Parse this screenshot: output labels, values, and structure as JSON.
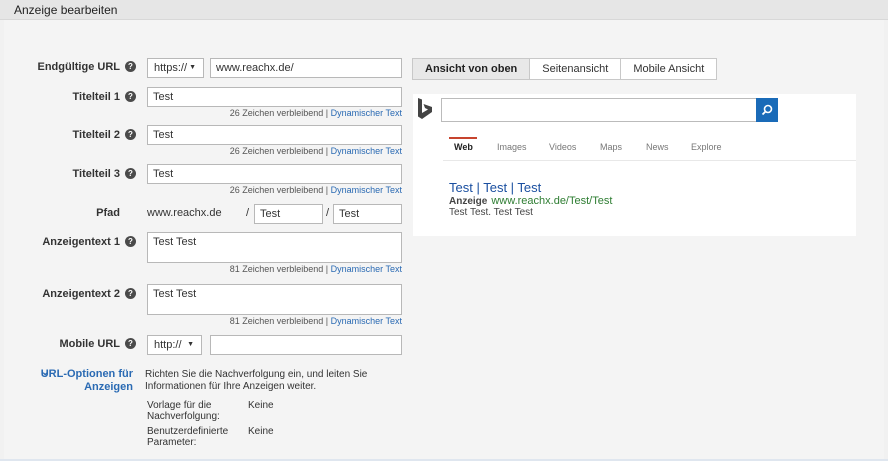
{
  "header": {
    "title": "Anzeige bearbeiten"
  },
  "form": {
    "final_url": {
      "label": "Endgültige URL",
      "protocol": "https://",
      "value": "www.reachx.de/"
    },
    "title1": {
      "label": "Titelteil 1",
      "value": "Test",
      "counter": "26 Zeichen verbleibend |",
      "dynamic": "Dynamischer Text"
    },
    "title2": {
      "label": "Titelteil 2",
      "value": "Test",
      "counter": "26 Zeichen verbleibend |",
      "dynamic": "Dynamischer Text"
    },
    "title3": {
      "label": "Titelteil 3",
      "value": "Test",
      "counter": "26 Zeichen verbleibend |",
      "dynamic": "Dynamischer Text"
    },
    "path": {
      "label": "Pfad",
      "domain": "www.reachx.de",
      "sep1": "/",
      "path1": "Test",
      "sep2": "/",
      "path2": "Test"
    },
    "text1": {
      "label": "Anzeigentext 1",
      "value": "Test Test",
      "counter": "81 Zeichen verbleibend |",
      "dynamic": "Dynamischer Text"
    },
    "text2": {
      "label": "Anzeigentext 2",
      "value": "Test Test",
      "counter": "81 Zeichen verbleibend |",
      "dynamic": "Dynamischer Text"
    },
    "mobile_url": {
      "label": "Mobile URL",
      "protocol": "http://",
      "value": ""
    },
    "url_options": {
      "label_line1": "URL-Optionen für",
      "label_line2": "Anzeigen",
      "description_line1": "Richten Sie die Nachverfolgung ein, und leiten Sie",
      "description_line2": "Informationen für Ihre Anzeigen weiter.",
      "tracking_label_line1": "Vorlage für die",
      "tracking_label_line2": "Nachverfolgung:",
      "tracking_value": "Keine",
      "custom_label_line1": "Benutzerdefinierte",
      "custom_label_line2": "Parameter:",
      "custom_value": "Keine"
    }
  },
  "preview_tabs": [
    "Ansicht von oben",
    "Seitenansicht",
    "Mobile Ansicht"
  ],
  "preview": {
    "nav": [
      "Web",
      "Images",
      "Videos",
      "Maps",
      "News",
      "Explore"
    ],
    "ad_title": "Test | Test | Test",
    "ad_badge": "Anzeige",
    "ad_url": "www.reachx.de/Test/Test",
    "ad_description": "Test Test. Test Test"
  },
  "colors": {
    "accent": "#1a6bb8",
    "link": "#2a6ab3",
    "ad_url": "#2e7d32",
    "nav_underline": "#c7442e"
  }
}
